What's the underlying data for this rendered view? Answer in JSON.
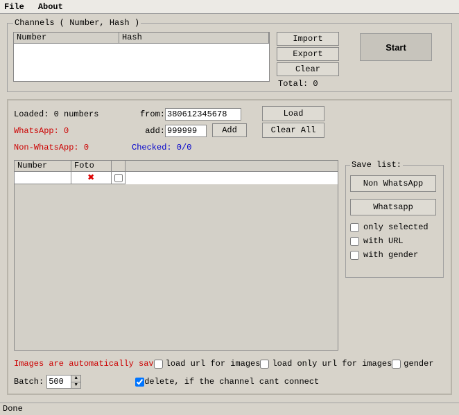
{
  "menu": {
    "file": "File",
    "about": "About"
  },
  "channels": {
    "legend": "Channels ( Number, Hash )",
    "col_number": "Number",
    "col_hash": "Hash",
    "import": "Import",
    "export": "Export",
    "clear": "Clear",
    "total": "Total: 0"
  },
  "start": "Start",
  "loader": {
    "loaded": "Loaded: 0 numbers",
    "from_label": "from:",
    "from_value": "380612345678",
    "load": "Load",
    "whatsapp": "WhatsApp: 0",
    "add_label": "add:",
    "add_value": "999999",
    "add_btn": "Add",
    "clear_all": "Clear All",
    "nonwa": "Non-WhatsApp: 0",
    "checked": "Checked: 0/0"
  },
  "numlist": {
    "col_number": "Number",
    "col_foto": "Foto"
  },
  "savelist": {
    "legend": "Save list:",
    "nonwa_btn": "Non WhatsApp",
    "wa_btn": "Whatsapp",
    "only_selected": "only selected",
    "with_url": "with URL",
    "with_gender": "with gender"
  },
  "opts": {
    "images_auto": "Images are automatically sav",
    "load_url": "load url for images",
    "load_only_url": "load only url for images",
    "gender": "gender",
    "batch_label": "Batch:",
    "batch_value": "500",
    "delete_if": "delete, if the channel cant connect"
  },
  "status": "Done"
}
